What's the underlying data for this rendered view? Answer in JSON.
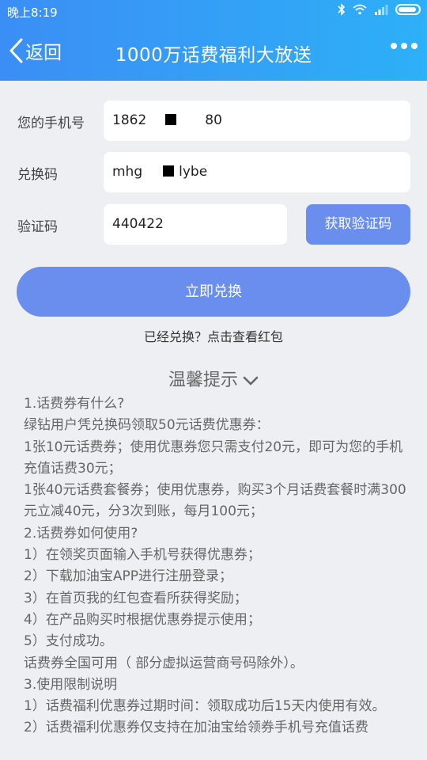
{
  "status": {
    "time": "晚上8:19"
  },
  "nav": {
    "back_label": "返回",
    "title": "1000万话费福利大放送"
  },
  "form": {
    "phone_label": "您的手机号",
    "phone_prefix": "1862",
    "phone_suffix": "80",
    "code_label": "兑换码",
    "code_prefix": "mhg",
    "code_suffix": "lybe",
    "verify_label": "验证码",
    "verify_value": "440422",
    "get_code_label": "获取验证码"
  },
  "actions": {
    "exchange_label": "立即兑换",
    "view_redeemed_label": "已经兑换？点击查看红包"
  },
  "tips": {
    "title": "温馨提示",
    "lines": [
      "1.话费券有什么?",
      "绿钻用户凭兑换码领取50元话费优惠券：",
      "1张10元话费券；使用优惠券您只需支付20元，即可为您的手机充值话费30元；",
      "1张40元话费套餐券；使用优惠券，购买3个月话费套餐时满300元立减40元，分3次到账，每月100元；",
      "2.话费券如何使用?",
      "1）在领奖页面输入手机号获得优惠券；",
      "2）下载加油宝APP进行注册登录；",
      "3）在首页我的红包查看所获得奖励；",
      "4）在产品购买时根据优惠券提示使用；",
      "5）支付成功。",
      "话费券全国可用（ 部分虚拟运营商号码除外）。",
      "3.使用限制说明",
      "1）话费福利优惠券过期时间：领取成功后15天内使用有效。",
      "2）话费福利优惠券仅支持在加油宝给领券手机号充值话费"
    ]
  }
}
